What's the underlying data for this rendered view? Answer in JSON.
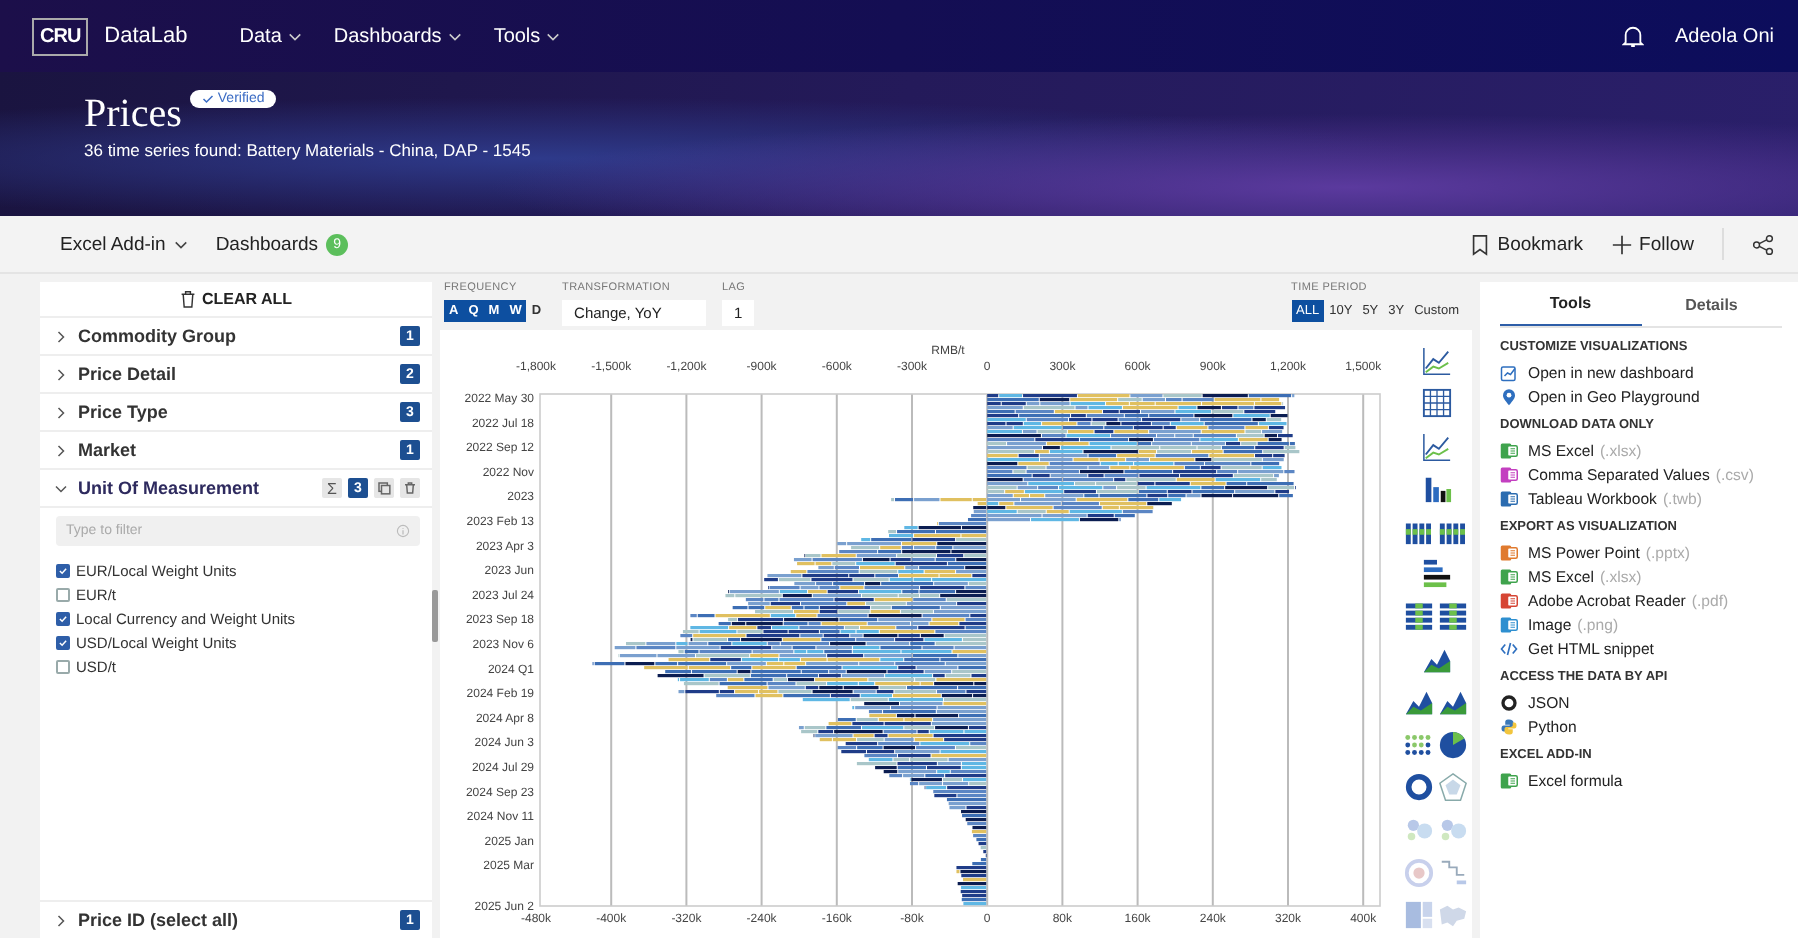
{
  "nav": {
    "logo": "CRU",
    "app_name": "DataLab",
    "menus": [
      "Data",
      "Dashboards",
      "Tools"
    ],
    "user": "Adeola Oni"
  },
  "header": {
    "title": "Prices",
    "badge": "Verified",
    "subtitle": "36 time series found: Battery Materials - China, DAP - 1545"
  },
  "toolbar": {
    "left": [
      {
        "label": "Excel Add-in",
        "kind": "dropdown"
      },
      {
        "label": "Dashboards",
        "kind": "counter",
        "count": "9"
      }
    ],
    "right": [
      {
        "label": "Bookmark",
        "kind": "bookmark"
      },
      {
        "label": "Follow",
        "kind": "follow"
      }
    ]
  },
  "filters": {
    "clear_all": "CLEAR ALL",
    "groups": [
      {
        "name": "Commodity Group",
        "count": "1",
        "expanded": false
      },
      {
        "name": "Price Detail",
        "count": "2",
        "expanded": false
      },
      {
        "name": "Price Type",
        "count": "3",
        "expanded": false
      },
      {
        "name": "Market",
        "count": "1",
        "expanded": false
      },
      {
        "name": "Unit Of Measurement",
        "count": "3",
        "expanded": true,
        "sum_symbol": "Σ",
        "filter_placeholder": "Type to filter",
        "options": [
          {
            "label": "EUR/Local Weight Units",
            "checked": true
          },
          {
            "label": "EUR/t",
            "checked": false
          },
          {
            "label": "Local Currency and Weight Units",
            "checked": true
          },
          {
            "label": "USD/Local Weight Units",
            "checked": true
          },
          {
            "label": "USD/t",
            "checked": false
          }
        ]
      }
    ],
    "footer_group": {
      "name": "Price ID (select all)",
      "count": "1",
      "expanded": false
    }
  },
  "controls": {
    "frequency_label": "FREQUENCY",
    "frequencies": [
      {
        "label": "A",
        "selected": true
      },
      {
        "label": "Q",
        "selected": true
      },
      {
        "label": "M",
        "selected": true
      },
      {
        "label": "W",
        "selected": true
      },
      {
        "label": "D",
        "selected": false
      }
    ],
    "transformation_label": "TRANSFORMATION",
    "transformation": "Change, YoY",
    "lag_label": "LAG",
    "lag": "1",
    "time_period_label": "TIME PERIOD",
    "time_periods": [
      {
        "label": "ALL",
        "selected": true
      },
      {
        "label": "10Y",
        "selected": false
      },
      {
        "label": "5Y",
        "selected": false
      },
      {
        "label": "3Y",
        "selected": false
      },
      {
        "label": "Custom",
        "selected": false
      }
    ]
  },
  "chart": {
    "unit": "RMB/t",
    "top_axis": [
      "-1,800k",
      "-1,500k",
      "-1,200k",
      "-900k",
      "-600k",
      "-300k",
      "0",
      "300k",
      "600k",
      "900k",
      "1,200k",
      "1,500k"
    ],
    "bottom_axis": [
      "-480k",
      "-400k",
      "-320k",
      "-240k",
      "-160k",
      "-80k",
      "0",
      "80k",
      "160k",
      "240k",
      "320k",
      "400k"
    ],
    "y_labels": [
      "2022 May 30",
      "2022 Jul 18",
      "2022 Sep 12",
      "2022 Nov",
      "2023",
      "2023 Feb 13",
      "2023 Apr 3",
      "2023 Jun",
      "2023 Jul 24",
      "2023 Sep 18",
      "2023 Nov 6",
      "2024 Q1",
      "2024 Feb 19",
      "2024 Apr 8",
      "2024 Jun 3",
      "2024 Jul 29",
      "2024 Sep 23",
      "2024 Nov 11",
      "2025 Jan",
      "2025 Mar",
      "2025 Jun 2"
    ]
  },
  "tools_panel": {
    "tabs": [
      {
        "label": "Tools",
        "selected": true
      },
      {
        "label": "Details",
        "selected": false
      }
    ],
    "sections": [
      {
        "heading": "CUSTOMIZE VISUALIZATIONS",
        "items": [
          {
            "label": "Open in new dashboard",
            "kind": "dashboard"
          },
          {
            "label": "Open in Geo Playground",
            "kind": "geo"
          }
        ]
      },
      {
        "heading": "DOWNLOAD DATA ONLY",
        "items": [
          {
            "label": "MS Excel",
            "ext": "(.xlsx)",
            "kind": "file",
            "color": "#3fa34d"
          },
          {
            "label": "Comma Separated Values",
            "ext": "(.csv)",
            "kind": "file",
            "color": "#c33fc0"
          },
          {
            "label": "Tableau Workbook",
            "ext": "(.twb)",
            "kind": "file",
            "color": "#2b6cb0"
          }
        ]
      },
      {
        "heading": "EXPORT AS VISUALIZATION",
        "items": [
          {
            "label": "MS Power Point",
            "ext": "(.pptx)",
            "kind": "file",
            "color": "#e07a2e"
          },
          {
            "label": "MS Excel",
            "ext": "(.xlsx)",
            "kind": "file",
            "color": "#3fa34d"
          },
          {
            "label": "Adobe Acrobat Reader",
            "ext": "(.pdf)",
            "kind": "file",
            "color": "#d64534"
          },
          {
            "label": "Image",
            "ext": "(.png)",
            "kind": "file",
            "color": "#2e8fd0"
          },
          {
            "label": "Get HTML snippet",
            "kind": "code"
          }
        ]
      },
      {
        "heading": "ACCESS THE DATA BY API",
        "items": [
          {
            "label": "JSON",
            "kind": "json"
          },
          {
            "label": "Python",
            "kind": "python"
          }
        ]
      },
      {
        "heading": "EXCEL ADD-IN",
        "items": [
          {
            "label": "Excel formula",
            "kind": "file",
            "color": "#3fa34d"
          }
        ]
      }
    ]
  }
}
